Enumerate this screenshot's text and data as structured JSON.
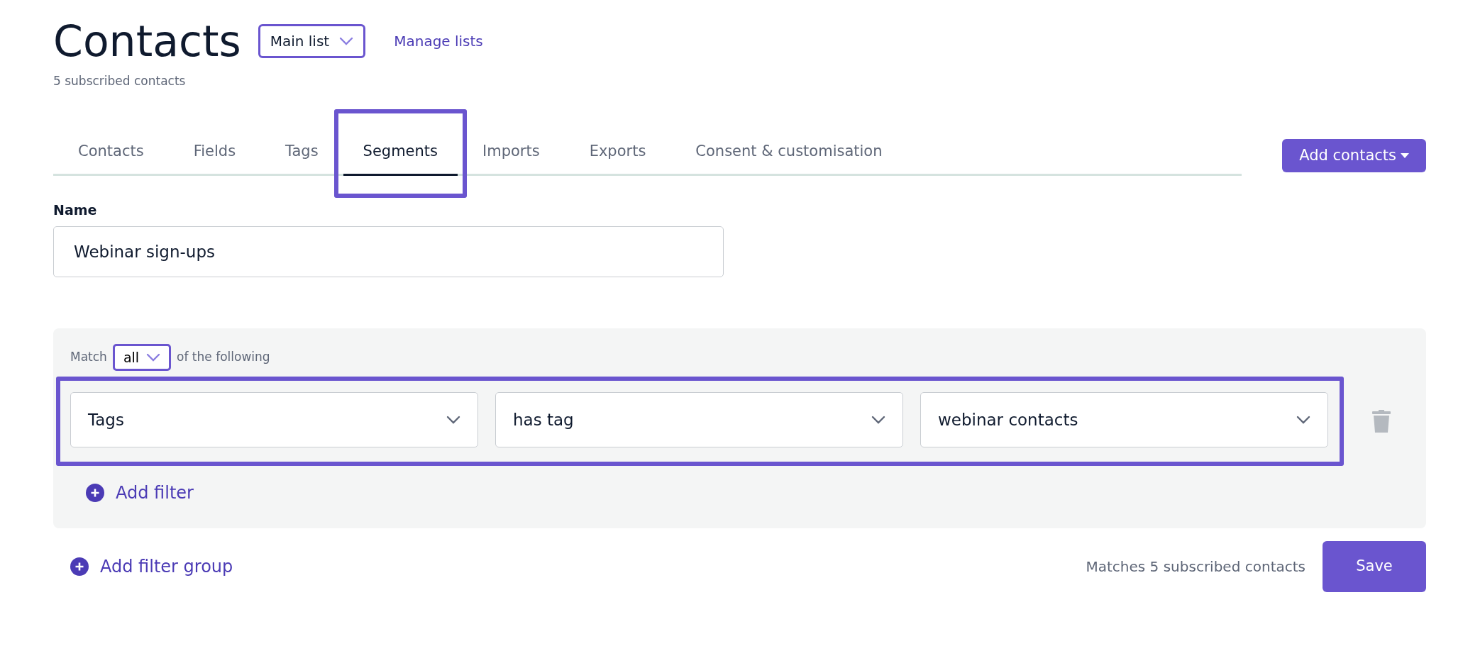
{
  "header": {
    "title": "Contacts",
    "list_select": {
      "value": "Main list"
    },
    "manage_link": "Manage lists",
    "subscribed_count": "5 subscribed contacts"
  },
  "tabs": [
    {
      "label": "Contacts",
      "selected": false
    },
    {
      "label": "Fields",
      "selected": false
    },
    {
      "label": "Tags",
      "selected": false
    },
    {
      "label": "Segments",
      "selected": true
    },
    {
      "label": "Imports",
      "selected": false
    },
    {
      "label": "Exports",
      "selected": false
    },
    {
      "label": "Consent & customisation",
      "selected": false
    }
  ],
  "add_contacts_button": "Add contacts",
  "name_field": {
    "label": "Name",
    "value": "Webinar sign-ups"
  },
  "filter_group": {
    "match_label": "Match",
    "match_value": "all",
    "match_suffix": "of the following",
    "filters": [
      {
        "field": "Tags",
        "operator": "has tag",
        "value": "webinar contacts"
      }
    ],
    "add_filter": "Add filter"
  },
  "add_filter_group": "Add filter group",
  "matches_text": "Matches 5 subscribed contacts",
  "save_button": "Save"
}
